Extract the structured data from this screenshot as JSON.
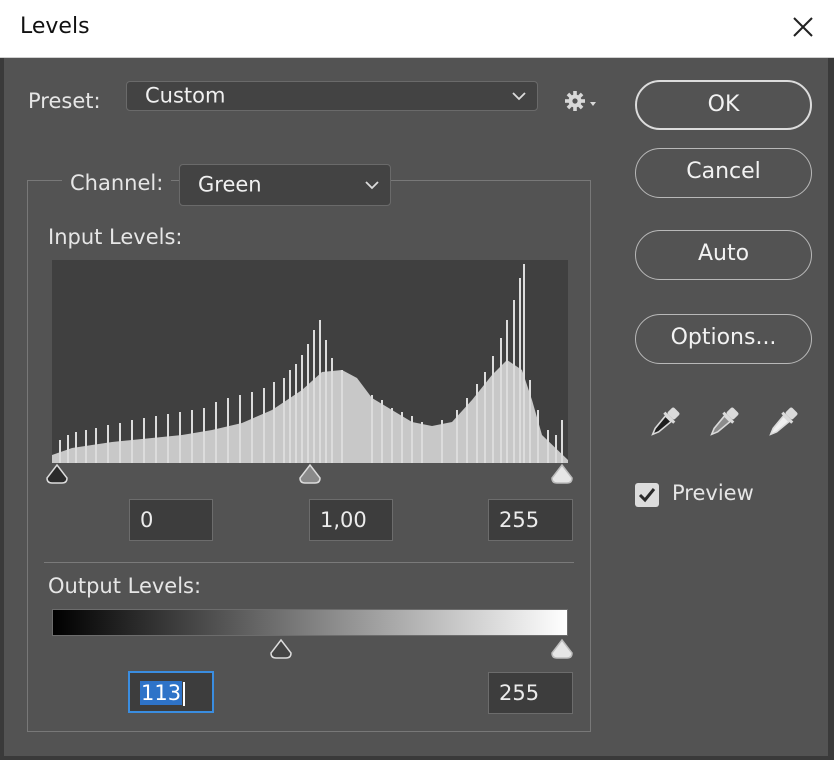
{
  "window": {
    "title": "Levels",
    "close_icon": "close-icon"
  },
  "preset": {
    "label": "Preset:",
    "value": "Custom",
    "options_icon": "gear-icon"
  },
  "channel": {
    "label": "Channel:",
    "value": "Green"
  },
  "input_levels": {
    "label": "Input Levels:",
    "black": "0",
    "gamma": "1,00",
    "white": "255"
  },
  "output_levels": {
    "label": "Output Levels:",
    "black": "113",
    "white": "255"
  },
  "buttons": {
    "ok": "OK",
    "cancel": "Cancel",
    "auto": "Auto",
    "options": "Options..."
  },
  "eyedroppers": [
    "black-point-eyedropper-icon",
    "gray-point-eyedropper-icon",
    "white-point-eyedropper-icon"
  ],
  "preview": {
    "label": "Preview",
    "checked": true
  },
  "colors": {
    "dialog_bg": "#535353",
    "histogram_bg": "#404040",
    "histogram_fill": "#c8c8c8",
    "selection": "#2e73c8"
  }
}
